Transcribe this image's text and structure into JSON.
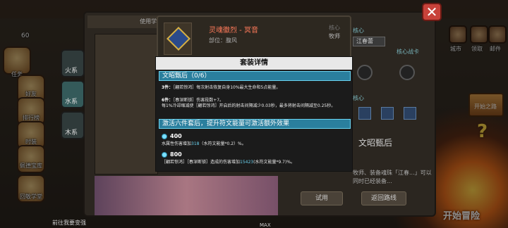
{
  "top": {
    "coins": "60"
  },
  "left_menu": [
    {
      "label": "任务"
    },
    {
      "label": "好友"
    },
    {
      "label": "排行榜"
    },
    {
      "label": "时装"
    },
    {
      "label": "佩德宝库"
    },
    {
      "label": "回敬学堂"
    }
  ],
  "right_menu": [
    {
      "label": "城市"
    },
    {
      "label": "领取"
    },
    {
      "label": "邮件"
    },
    {
      "label": "开始之路"
    }
  ],
  "start_button": "开始冒险",
  "main_panel": {
    "title": "使用学堂BD装",
    "close": "✕",
    "element_tabs": [
      "火系",
      "水系",
      "木系"
    ],
    "bottom_link": "前往我要变强",
    "max": "MAX"
  },
  "item": {
    "name": "灵魂徽烈 - 冥音",
    "slot": "部位：腹风",
    "role_label": "核心",
    "role_value": "牧师"
  },
  "side": {
    "label1": "核心",
    "dropdown": "江春蕾",
    "label2": "核心战卡",
    "label3": "核心",
    "set_name": "文昭甄后",
    "desc": "牧师、装备魂珠「江春...」可以同时已经装备...",
    "btn_trial": "试用",
    "btn_return": "返回路线"
  },
  "popup": {
    "title": "套装详情",
    "set_header": "文昭甄后（0/6）",
    "bonus3_tag": "3件：",
    "bonus3_text": "［翩若惊鸿］每次射击恢复自身10%最大生命和5点能量。",
    "bonus6_tag": "6件：",
    "bonus6_line1": "［春深断锁］伤害段数+7。",
    "bonus6_line2": "每1%冷却缩减使［翩若惊鸿］开启后的射击间隔减少0.03秒，最多将射击间隔减至0.25秒。",
    "activate_header": "激活六件套后，提升符文能量可激活额外效果",
    "energy1_value": "400",
    "energy1_text_pre": "水属性伤害增加",
    "energy1_num": "318",
    "energy1_text_post": "（水符文能量*0.2）%。",
    "energy2_value": "800",
    "energy2_text_pre": "［翩若惊鸿］［春深断锁］造成的伤害增加",
    "energy2_num": "15423",
    "energy2_text_post": "(水符文能量*9.7)%。"
  },
  "colors": {
    "section_bar": "#2a7f9e",
    "highlight": "#6ad2ee",
    "item_name": "#ff7a5a",
    "close_button": "#c8423a"
  }
}
